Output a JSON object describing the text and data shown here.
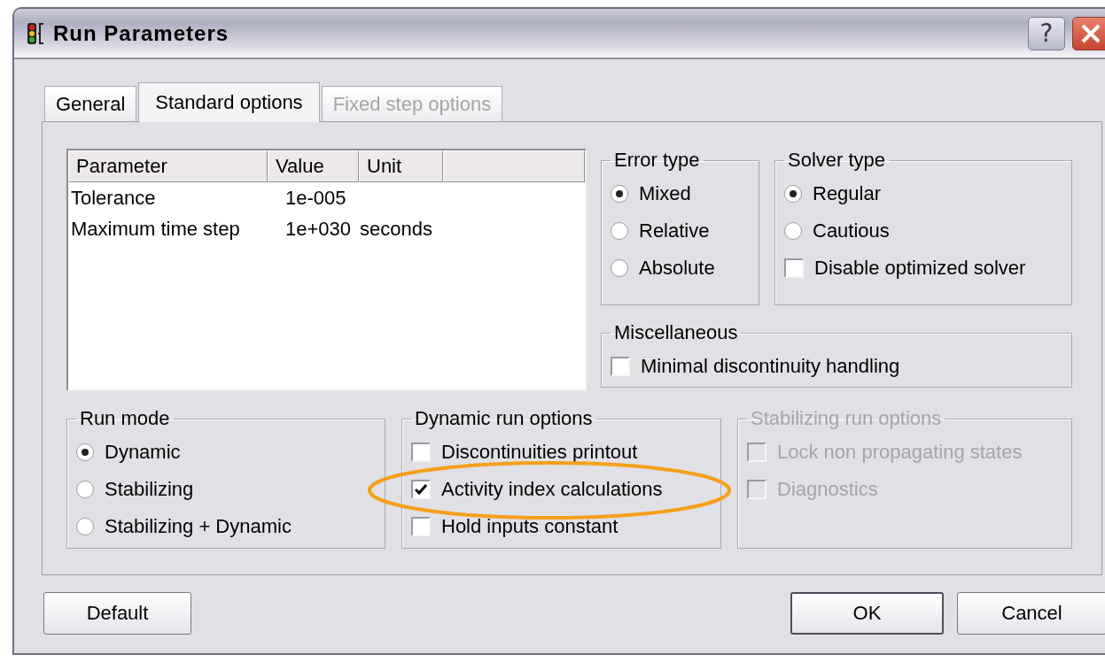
{
  "window": {
    "title": "Run Parameters"
  },
  "help_button": {
    "label": "?"
  },
  "tabs": [
    {
      "label": "General",
      "selected": false,
      "disabled": false
    },
    {
      "label": "Standard options",
      "selected": true,
      "disabled": false
    },
    {
      "label": "Fixed step options",
      "selected": false,
      "disabled": true
    }
  ],
  "parameter_table": {
    "columns": [
      "Parameter",
      "Value",
      "Unit"
    ],
    "rows": [
      {
        "parameter": "Tolerance",
        "value": "1e-005"
      },
      {
        "parameter": "Maximum time step",
        "value": "1e+030",
        "unit": "seconds"
      }
    ]
  },
  "error_type": {
    "title": "Error type",
    "disabled": false,
    "items": [
      {
        "kind": "radio",
        "label": "Mixed",
        "selected": true
      },
      {
        "kind": "radio",
        "label": "Relative",
        "selected": false
      },
      {
        "kind": "radio",
        "label": "Absolute",
        "selected": false
      }
    ]
  },
  "solver_type": {
    "title": "Solver type",
    "disabled": false,
    "items": [
      {
        "kind": "radio",
        "label": "Regular",
        "selected": true
      },
      {
        "kind": "radio",
        "label": "Cautious",
        "selected": false
      },
      {
        "kind": "checkbox",
        "label": "Disable optimized solver",
        "checked": false
      }
    ]
  },
  "miscellaneous": {
    "title": "Miscellaneous",
    "disabled": false,
    "items": [
      {
        "kind": "checkbox",
        "label": "Minimal discontinuity handling",
        "checked": false
      }
    ]
  },
  "run_mode": {
    "title": "Run mode",
    "disabled": false,
    "items": [
      {
        "kind": "radio",
        "label": "Dynamic",
        "selected": true
      },
      {
        "kind": "radio",
        "label": "Stabilizing",
        "selected": false
      },
      {
        "kind": "radio",
        "label": "Stabilizing + Dynamic",
        "selected": false
      }
    ]
  },
  "dynamic_run_options": {
    "title": "Dynamic run options",
    "disabled": false,
    "items": [
      {
        "kind": "checkbox",
        "label": "Discontinuities printout",
        "checked": false
      },
      {
        "kind": "checkbox",
        "label": "Activity index calculations",
        "checked": true
      },
      {
        "kind": "checkbox",
        "label": "Hold inputs constant",
        "checked": false
      }
    ]
  },
  "stabilizing_run_options": {
    "title": "Stabilizing run options",
    "disabled": true,
    "items": [
      {
        "kind": "checkbox",
        "label": "Lock non propagating states",
        "checked": false
      },
      {
        "kind": "checkbox",
        "label": "Diagnostics",
        "checked": false
      }
    ]
  },
  "buttons": [
    {
      "label": "Default",
      "default": false
    },
    {
      "label": "OK",
      "default": true
    },
    {
      "label": "Cancel",
      "default": false
    }
  ]
}
